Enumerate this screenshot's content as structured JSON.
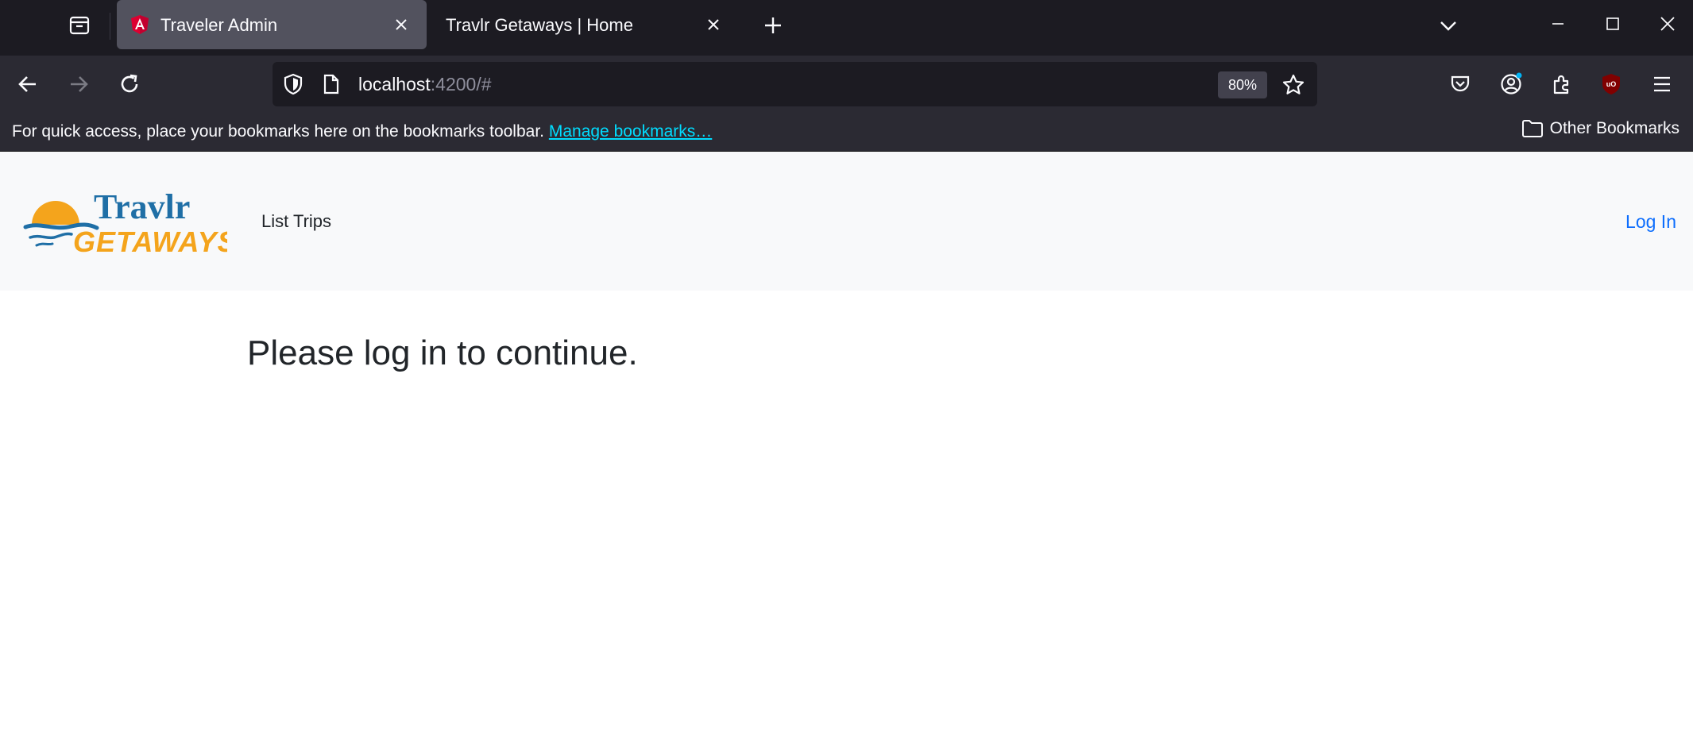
{
  "browser": {
    "tabs": [
      {
        "title": "Traveler Admin",
        "active": true,
        "favicon": "angular-icon"
      },
      {
        "title": "Travlr Getaways | Home",
        "active": false
      }
    ],
    "address": {
      "host": "localhost",
      "rest": ":4200/#"
    },
    "zoom": "80%",
    "bookmarks_bar": {
      "prompt": "For quick access, place your bookmarks here on the bookmarks toolbar.",
      "manage_link": "Manage bookmarks…",
      "other": "Other Bookmarks"
    }
  },
  "site": {
    "logo": {
      "line1": "Travlr",
      "line2": "GETAWAYS"
    },
    "nav": {
      "list_trips": "List Trips",
      "log_in": "Log In"
    },
    "message": "Please log in to continue."
  },
  "colors": {
    "link": "#0d6efd",
    "logo_blue": "#1f6fa6",
    "logo_orange": "#f4a41c"
  }
}
